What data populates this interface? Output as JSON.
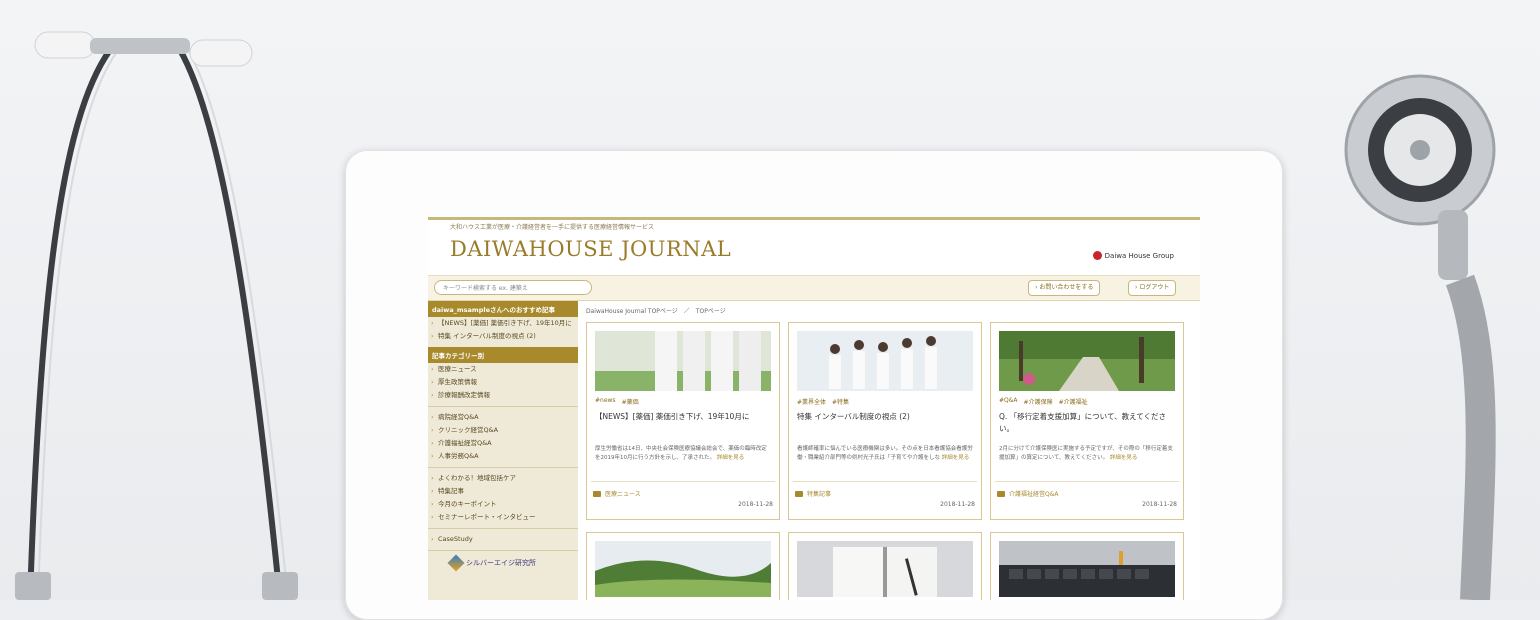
{
  "journal": {
    "tagline": "大和ハウス工業が医療・介護経営者を一手に提供する医療経営情報サービス",
    "logo": "DAIWAHOUSE JOURNAL",
    "group_logo": "Daiwa House Group",
    "search_placeholder": "キーワード検索する ex. 建築え",
    "contact_button": "お問い合わせをする",
    "logout_button": "ログアウト"
  },
  "sidebar": {
    "recommend_header": "daiwa_msampleさんへのおすすめ記事",
    "recommend_items": [
      "【NEWS】[薬価] 薬価引き下げ、19年10月に",
      "特集 インターバル制度の視点 (2)"
    ],
    "category_header": "記事カテゴリー別",
    "group1": [
      "医療ニュース",
      "厚生政策情報",
      "診療報酬改定情報"
    ],
    "group2": [
      "病院経営Q&A",
      "クリニック経営Q&A",
      "介護福祉経営Q&A",
      "人事労務Q&A"
    ],
    "group3": [
      "よくわかる！地域包括ケア",
      "特集記事",
      "今月のキーポイント",
      "セミナーレポート・インタビュー"
    ],
    "group4": [
      "CaseStudy"
    ],
    "silver_logo": "シルバーエイジ研究所"
  },
  "breadcrumb": "DaiwaHouse Journal TOPページ　／　TOPページ",
  "cards": [
    {
      "tags": [
        "#news",
        "#薬価"
      ],
      "title": "【NEWS】[薬価] 薬価引き下げ、19年10月に",
      "desc": "厚生労働省は14日、中央社会保険医療協議会総会で、薬価の臨時改定を2019年10月に行う方針を示し、了承された。",
      "more": "詳細を見る",
      "category": "医療ニュース",
      "date": "2018-11-28"
    },
    {
      "tags": [
        "#業界全体",
        "#特集"
      ],
      "title": "特集 インターバル制度の視点 (2)",
      "desc": "看護師確率に悩んでいる医療機関は多い。その点を日本看護協会看護労働・職業紹介部門等の県村光子氏は「子育てや介護をしな",
      "more": "詳細を見る",
      "category": "特集記事",
      "date": "2018-11-28"
    },
    {
      "tags": [
        "#Q&A",
        "#介護保険",
        "#介護福祉"
      ],
      "title": "Q. 「移行定着支援加算」について、教えてください。",
      "desc": "2月に分けて介護保険医に実施する予定ですが、その際の「移行定着支援加算」の算定について、教えてください。",
      "more": "詳細を見る",
      "category": "介護福祉経営Q&A",
      "date": "2018-11-28"
    }
  ]
}
